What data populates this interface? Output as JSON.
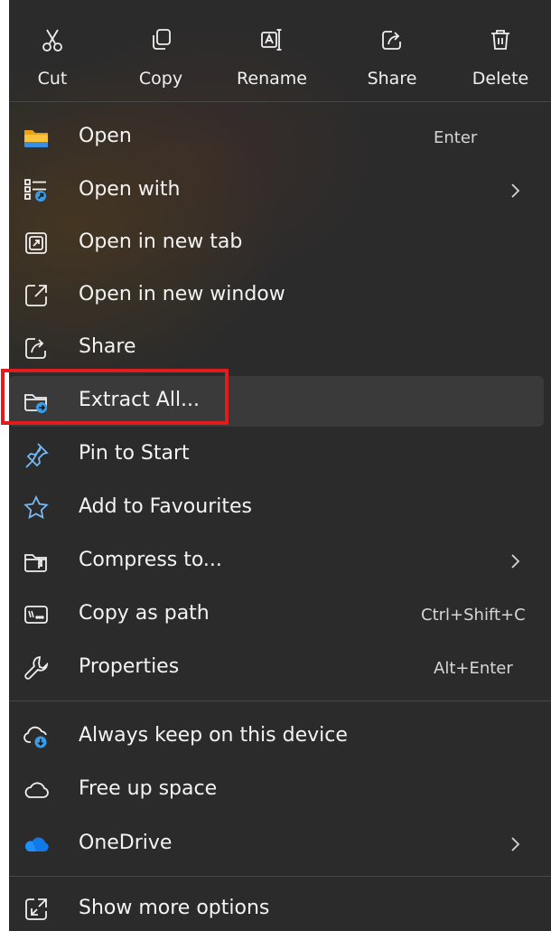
{
  "toolbar": {
    "cut": "Cut",
    "copy": "Copy",
    "rename": "Rename",
    "share": "Share",
    "delete": "Delete"
  },
  "items": [
    {
      "label": "Open",
      "shortcut": "Enter",
      "icon": "folder-icon"
    },
    {
      "label": "Open with",
      "icon": "open-with-icon",
      "submenu": true
    },
    {
      "label": "Open in new tab",
      "icon": "new-tab-icon"
    },
    {
      "label": "Open in new window",
      "icon": "new-window-icon"
    },
    {
      "label": "Share",
      "icon": "share-icon"
    },
    {
      "label": "Extract All...",
      "icon": "extract-folder-icon"
    },
    {
      "label": "Pin to Start",
      "icon": "pin-icon"
    },
    {
      "label": "Add to Favourites",
      "icon": "star-icon"
    },
    {
      "label": "Compress to...",
      "icon": "compress-icon",
      "submenu": true
    },
    {
      "label": "Copy as path",
      "shortcut": "Ctrl+Shift+C",
      "icon": "path-icon"
    },
    {
      "label": "Properties",
      "shortcut": "Alt+Enter",
      "icon": "wrench-icon"
    },
    {
      "label": "Always keep on this device",
      "icon": "cloud-sync-icon"
    },
    {
      "label": "Free up space",
      "icon": "cloud-icon"
    },
    {
      "label": "OneDrive",
      "icon": "onedrive-icon",
      "submenu": true
    },
    {
      "label": "Show more options",
      "icon": "more-options-icon"
    }
  ],
  "colors": {
    "background": "#2b2b2b",
    "text": "#f3f3f3",
    "highlight_border": "#e01c1c",
    "onedrive_blue": "#1e8fff",
    "folder_yellow": "#f8c33a"
  }
}
